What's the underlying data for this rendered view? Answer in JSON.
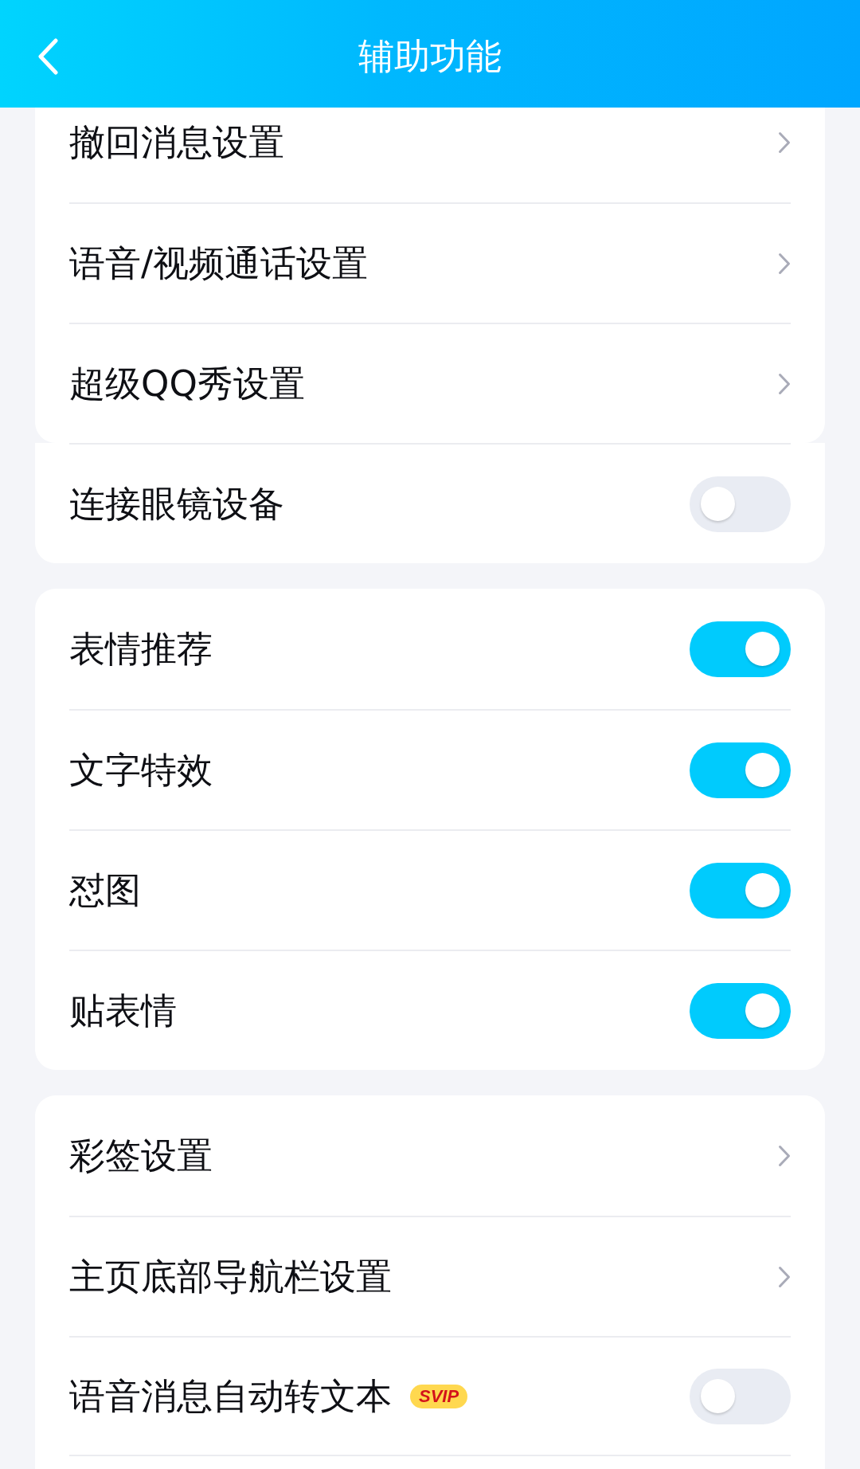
{
  "header": {
    "title": "辅助功能"
  },
  "groups": [
    {
      "joined": false,
      "continues": false,
      "rows": [
        {
          "kind": "link",
          "label": "撤回消息设置"
        },
        {
          "kind": "link",
          "label": "语音/视频通话设置"
        },
        {
          "kind": "link",
          "label": "超级QQ秀设置"
        }
      ]
    },
    {
      "joined": true,
      "continues": false,
      "rows": [
        {
          "kind": "toggle",
          "label": "连接眼镜设备",
          "on": false
        }
      ]
    },
    {
      "joined": false,
      "continues": false,
      "rows": [
        {
          "kind": "toggle",
          "label": "表情推荐",
          "on": true
        },
        {
          "kind": "toggle",
          "label": "文字特效",
          "on": true
        },
        {
          "kind": "toggle",
          "label": "怼图",
          "on": true
        },
        {
          "kind": "toggle",
          "label": "贴表情",
          "on": true
        }
      ]
    },
    {
      "joined": false,
      "continues": true,
      "rows": [
        {
          "kind": "link",
          "label": "彩签设置"
        },
        {
          "kind": "link",
          "label": "主页底部导航栏设置"
        },
        {
          "kind": "toggle",
          "label": "语音消息自动转文本",
          "badge": "SVIP",
          "on": false
        }
      ]
    }
  ]
}
